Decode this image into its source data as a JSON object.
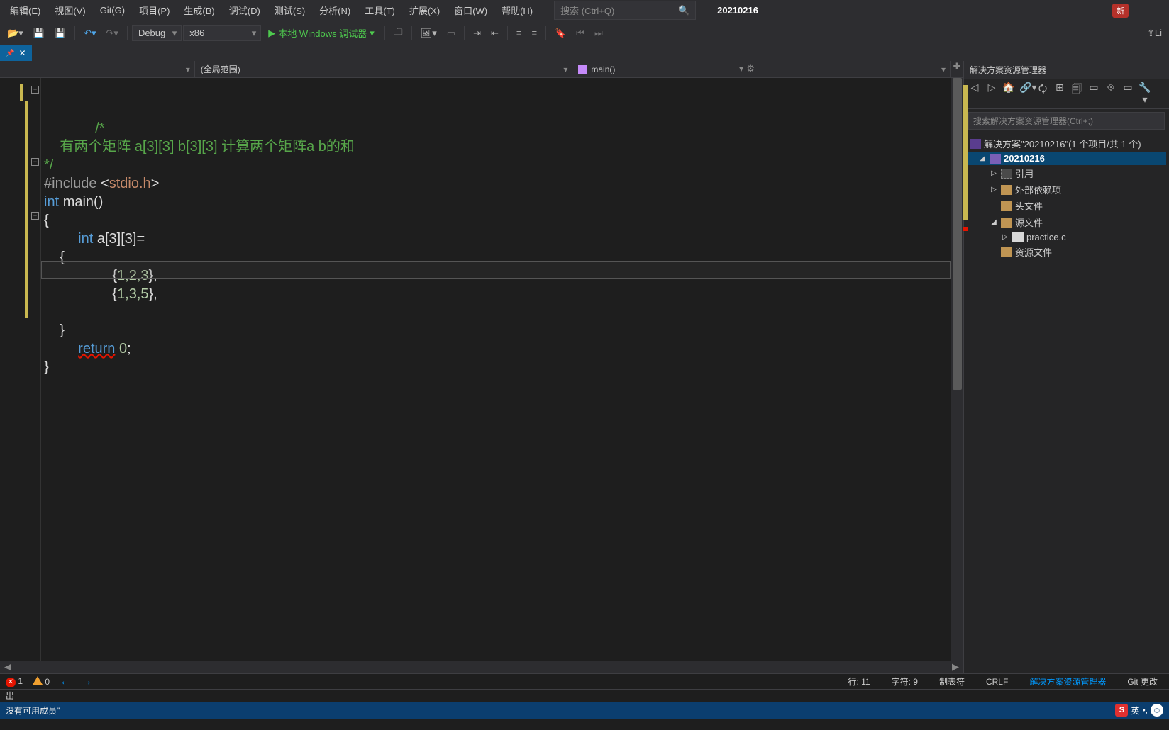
{
  "menubar": {
    "items": [
      "编辑(E)",
      "视图(V)",
      "Git(G)",
      "项目(P)",
      "生成(B)",
      "调试(D)",
      "测试(S)",
      "分析(N)",
      "工具(T)",
      "扩展(X)",
      "窗口(W)",
      "帮助(H)"
    ],
    "search_placeholder": "搜索 (Ctrl+Q)",
    "project": "20210216",
    "new_badge": "新",
    "live_label": "Li"
  },
  "toolbar": {
    "config_combo": "Debug",
    "platform_combo": "x86",
    "run_label": "本地 Windows 调试器"
  },
  "tab": {
    "close": "✕"
  },
  "navbar": {
    "scope": "(全局范围)",
    "member": "main()"
  },
  "code": {
    "lines": [
      {
        "t": "comment",
        "text": "/*"
      },
      {
        "t": "comment",
        "text": "    有两个矩阵 a[3][3] b[3][3] 计算两个矩阵a b的和"
      },
      {
        "t": "comment",
        "text": "*/"
      },
      {
        "t": "include",
        "pre": "#include ",
        "lt": "<",
        "lib": "stdio.h",
        "gt": ">"
      },
      {
        "t": "func",
        "kw": "int ",
        "name": "main",
        "paren": "()"
      },
      {
        "t": "plain",
        "text": "{"
      },
      {
        "t": "decl",
        "indent": "    ",
        "kw": "int ",
        "name": "a",
        "bracket": "[3][3]="
      },
      {
        "t": "plain",
        "text": "    {"
      },
      {
        "t": "arr",
        "indent": "        ",
        "open": "{",
        "vals": "1,2,3",
        "close": "},"
      },
      {
        "t": "arr",
        "indent": "        ",
        "open": "{",
        "vals": "1,3,5",
        "close": "},"
      },
      {
        "t": "empty",
        "text": ""
      },
      {
        "t": "plain",
        "text": "    }"
      },
      {
        "t": "ret",
        "indent": "    ",
        "kw": "return ",
        "val": "0",
        "semi": ";"
      },
      {
        "t": "plain",
        "text": "}"
      }
    ]
  },
  "side": {
    "title": "解决方案资源管理器",
    "search_placeholder": "搜索解决方案资源管理器(Ctrl+;)",
    "solution": "解决方案\"20210216\"(1 个项目/共 1 个)",
    "tree": {
      "project": "20210216",
      "items": [
        "引用",
        "外部依赖项",
        "头文件",
        "源文件",
        "资源文件"
      ],
      "file": "practice.c"
    }
  },
  "status": {
    "errors": "1",
    "warnings": "0",
    "line": "行: 11",
    "char": "字符: 9",
    "tabs": "制表符",
    "crlf": "CRLF",
    "tab1": "解决方案资源管理器",
    "tab2": "Git 更改"
  },
  "output": {
    "label": "出"
  },
  "bottom": {
    "msg": "没有可用成员\"",
    "ime_s": "S",
    "ime_lang": "英",
    "ime_dot": "•,"
  }
}
